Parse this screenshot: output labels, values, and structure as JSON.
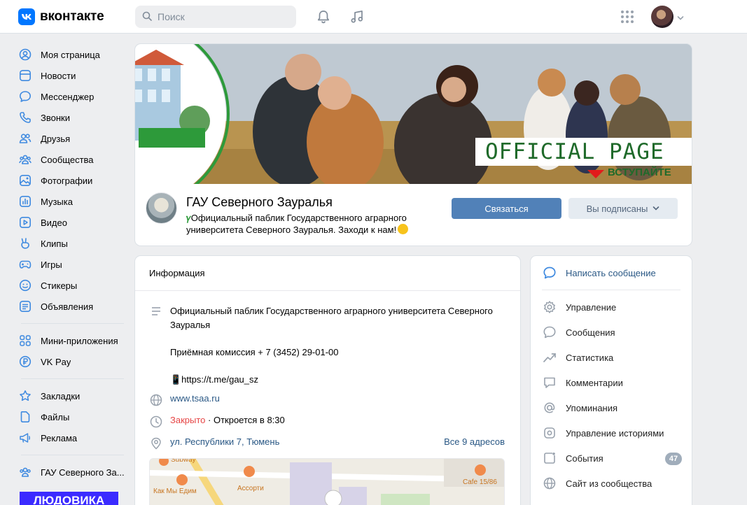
{
  "header": {
    "logo_letter": "VK",
    "logo_text": "вконтакте",
    "search_placeholder": "Поиск"
  },
  "nav": {
    "items": [
      {
        "label": "Моя страница",
        "icon": "user-circle-icon"
      },
      {
        "label": "Новости",
        "icon": "news-icon"
      },
      {
        "label": "Мессенджер",
        "icon": "message-icon"
      },
      {
        "label": "Звонки",
        "icon": "phone-icon"
      },
      {
        "label": "Друзья",
        "icon": "friends-icon"
      },
      {
        "label": "Сообщества",
        "icon": "communities-icon"
      },
      {
        "label": "Фотографии",
        "icon": "photo-icon"
      },
      {
        "label": "Музыка",
        "icon": "music-icon"
      },
      {
        "label": "Видео",
        "icon": "video-icon"
      },
      {
        "label": "Клипы",
        "icon": "clips-icon"
      },
      {
        "label": "Игры",
        "icon": "gamepad-icon"
      },
      {
        "label": "Стикеры",
        "icon": "smile-icon"
      },
      {
        "label": "Объявления",
        "icon": "ads-icon"
      }
    ],
    "items2": [
      {
        "label": "Мини-приложения",
        "icon": "apps-icon"
      },
      {
        "label": "VK Pay",
        "icon": "ruble-icon"
      }
    ],
    "items3": [
      {
        "label": "Закладки",
        "icon": "star-icon"
      },
      {
        "label": "Файлы",
        "icon": "file-icon"
      },
      {
        "label": "Реклама",
        "icon": "megaphone-icon"
      }
    ],
    "items4": [
      {
        "label": "ГАУ Северного За...",
        "icon": "communities-icon"
      }
    ],
    "promo_text": "ЛЮДОВИКА"
  },
  "cover": {
    "official_text": "OFFICIAL PAGE",
    "join_text": "ВСТУПАЙТЕ"
  },
  "group": {
    "title": "ГАУ Северного Зауралья",
    "status": "Официальный паблик Государственного аграрного университета Северного Зауралья. Заходи к нам!",
    "contact_button": "Связаться",
    "subscribed_button": "Вы подписаны"
  },
  "info": {
    "heading": "Информация",
    "description_line1": "Официальный паблик Государственного аграрного университета Северного Зауралья",
    "description_line2": "Приёмная комиссия + 7 (3452) 29-01-00",
    "description_link": "📱https://t.me/gau_sz",
    "website": "www.tsaa.ru",
    "status_closed": "Закрыто",
    "status_open": "· Откроется в 8:30",
    "address": "ул. Республики 7, Тюмень",
    "all_addresses": "Все 9 адресов",
    "map_labels": [
      "Subway",
      "Ассорти",
      "Как Мы Едим",
      "Cafe 15/86"
    ]
  },
  "actions": {
    "write_message": "Написать сообщение",
    "items": [
      {
        "label": "Управление",
        "icon": "gear-icon"
      },
      {
        "label": "Сообщения",
        "icon": "message-icon"
      },
      {
        "label": "Статистика",
        "icon": "chart-icon"
      },
      {
        "label": "Комментарии",
        "icon": "comment-icon"
      },
      {
        "label": "Упоминания",
        "icon": "at-icon"
      },
      {
        "label": "Управление историями",
        "icon": "stories-icon"
      },
      {
        "label": "События",
        "icon": "events-icon"
      },
      {
        "label": "Сайт из сообщества",
        "icon": "globe-icon"
      }
    ],
    "events_badge": "47"
  },
  "colors": {
    "accent": "#0077ff",
    "button_primary": "#5181b8",
    "link": "#2a5885",
    "closed": "#e64646",
    "icon": "#3f8ae0"
  }
}
